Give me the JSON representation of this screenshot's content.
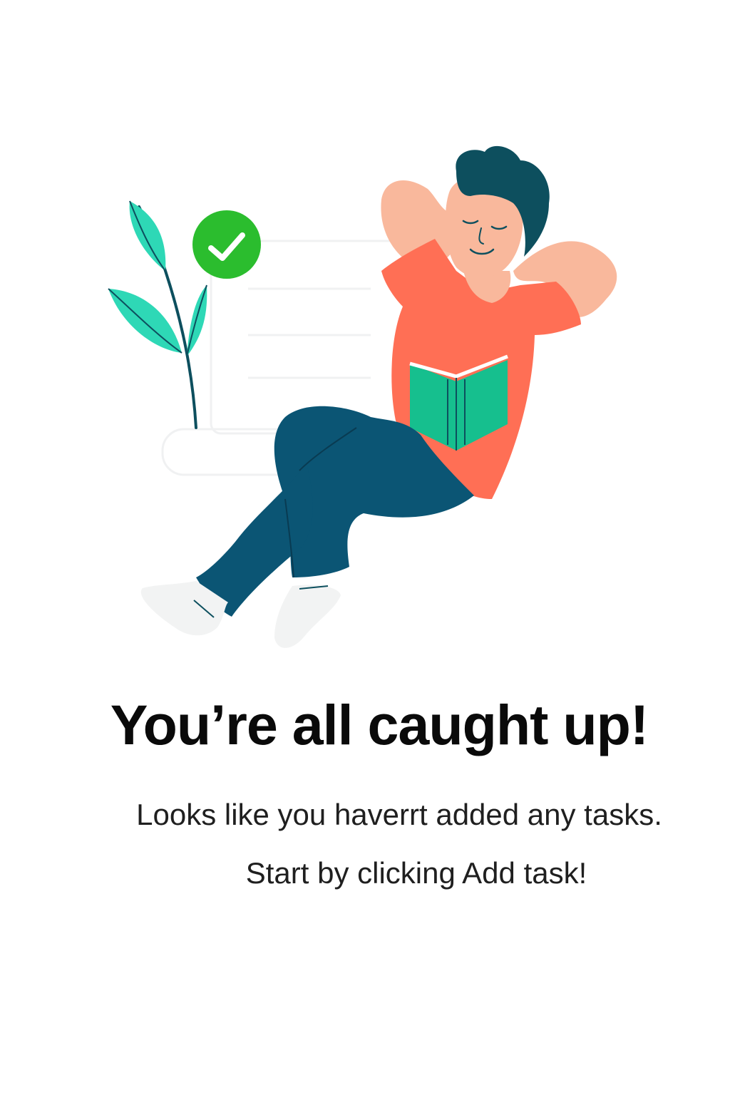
{
  "empty_state": {
    "title": "You’re all caught up!",
    "message_line1": "Looks like you haverrt added any tasks.",
    "message_line2": "Start by clicking Add task!"
  },
  "illustration": {
    "subject": "person-relaxing-with-book",
    "badge_icon": "check-circle-icon",
    "plant_icon": "plant-icon"
  },
  "colors": {
    "shirt": "#ff6f55",
    "pants": "#0b5574",
    "skin": "#f9b89c",
    "hair": "#0d4f5e",
    "book": "#16bf8e",
    "leaf": "#2ed8b6",
    "check_badge": "#2bbd2e",
    "text_primary": "#0a0a0a",
    "text_secondary": "#1f1f1f"
  }
}
